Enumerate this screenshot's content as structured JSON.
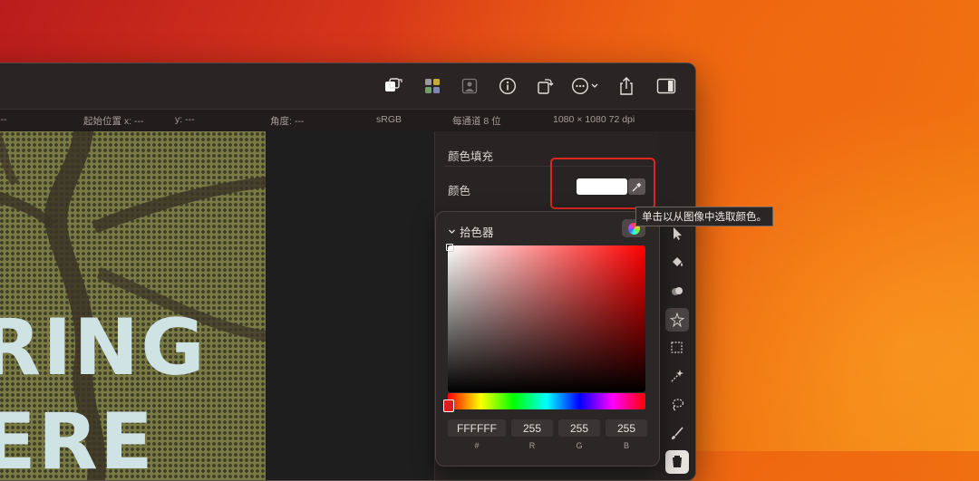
{
  "toolbar": {
    "icons": [
      "arrange-icon",
      "adjustments-icon",
      "photo-icon",
      "info-icon",
      "rotate-icon",
      "more-icon",
      "share-icon",
      "sidebar-icon"
    ]
  },
  "infobar": {
    "left_fragment": "---",
    "origin": "起始位置 x: ---",
    "y": "y: ---",
    "angle": "角度: ---",
    "colorspace": "sRGB",
    "depth": "每通道 8 位",
    "dimensions": "1080 × 1080 72 dpi"
  },
  "artwork": {
    "line1": "RING",
    "line2": "ERE"
  },
  "inspector": {
    "section_title": "颜色填充",
    "color_label": "颜色",
    "swatch_color": "#FFFFFF"
  },
  "tooltip": "单击以从图像中选取颜色。",
  "picker": {
    "title": "拾色器",
    "hex": "FFFFFF",
    "r": "255",
    "g": "255",
    "b": "255",
    "labels": {
      "hex": "#",
      "r": "R",
      "g": "G",
      "b": "B"
    }
  },
  "colors": {
    "highlight": "#E0271F",
    "artwork_bg": "#7A7B44",
    "artwork_text": "#CFE3E5"
  }
}
